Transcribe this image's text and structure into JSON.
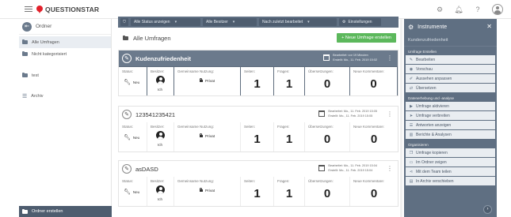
{
  "app": {
    "brand": "QUESTIONSTAR"
  },
  "topbar": {
    "icons": [
      "settings-icon",
      "bell-icon",
      "help-icon",
      "user-avatar-icon"
    ]
  },
  "sidebar": {
    "header": "Ordner",
    "items": [
      {
        "label": "Alle Umfragen",
        "active": true
      },
      {
        "label": "Nicht kategorisiert",
        "active": false
      },
      {
        "label": "test",
        "active": false
      },
      {
        "label": "Archiv",
        "active": false
      }
    ],
    "footer": "Ordner erstellen"
  },
  "filters": {
    "status": "Alle Status anzeigen",
    "owner": "Alle Besitzer",
    "sort": "Nach zuletzt bearbeitet",
    "settings": "Einstellungen"
  },
  "main": {
    "title": "Alle Umfragen",
    "new_button": "+ Neue Umfrage erstellen"
  },
  "labels": {
    "status": "Status:",
    "owner": "Besitzer:",
    "usage": "Gemeinsame Nutzung:",
    "pages": "Seiten:",
    "questions": "Fragen:",
    "responses": "Übersetzungen:",
    "comments": "Neue Kommentare:"
  },
  "surveys": [
    {
      "name": "Kudenzufriedenheit",
      "edited": "Bearbeitet: vor 19 Minuten",
      "created": "Erstellt: Mo., 11. Feb. 2019 15:02",
      "status": "Neu",
      "owner": "Ich",
      "usage": "Privat",
      "pages": "1",
      "questions": "1",
      "responses": "0",
      "comments": "0"
    },
    {
      "name": "123541235421",
      "edited": "Bearbeitet: Mo., 11. Feb. 2019 15:05",
      "created": "Erstellt: Mo., 11. Feb. 2019 15:05",
      "status": "Neu",
      "owner": "Ich",
      "usage": "Privat",
      "pages": "1",
      "questions": "1",
      "responses": "0",
      "comments": "0"
    },
    {
      "name": "asDASD",
      "edited": "Bearbeitet: Mo., 11. Feb. 2019 15:04",
      "created": "Erstellt: Mo., 11. Feb. 2019 15:04",
      "status": "Neu",
      "owner": "Ich",
      "usage": "Privat",
      "pages": "1",
      "questions": "1",
      "responses": "0",
      "comments": "0"
    }
  ],
  "instruments": {
    "title": "Instrumente",
    "subtitle": "Kundenzufriedenheit",
    "sections": [
      {
        "heading": "Umfrage Erstellen",
        "buttons": [
          {
            "label": "Bearbeiten",
            "icon": "pencil-icon"
          },
          {
            "label": "Vorschau",
            "icon": "eye-icon"
          },
          {
            "label": "Aussehen anpassen",
            "icon": "brush-icon"
          },
          {
            "label": "Übersetzen",
            "icon": "translate-icon"
          }
        ]
      },
      {
        "heading": "Datenerhebung und -analyse",
        "buttons": [
          {
            "label": "Umfrage aktivieren",
            "icon": "play-icon"
          },
          {
            "label": "Umfrage verbreiten",
            "icon": "send-icon"
          },
          {
            "label": "Antworten anzeigen",
            "icon": "list-icon"
          },
          {
            "label": "Berichte & Analysen",
            "icon": "chart-icon"
          }
        ]
      },
      {
        "heading": "Organisieren",
        "buttons": [
          {
            "label": "Umfrage kopieren",
            "icon": "copy-icon"
          },
          {
            "label": "Im Ordner zeigen",
            "icon": "folder-icon"
          },
          {
            "label": "Mit dem Team teilen",
            "icon": "share-icon"
          },
          {
            "label": "In Archiv verschieben",
            "icon": "archive-icon"
          }
        ]
      }
    ]
  },
  "colors": {
    "accent": "#5f6f82",
    "dark_accent": "#4e5d6f",
    "success": "#5cb85c",
    "brand": "#e2202a"
  }
}
